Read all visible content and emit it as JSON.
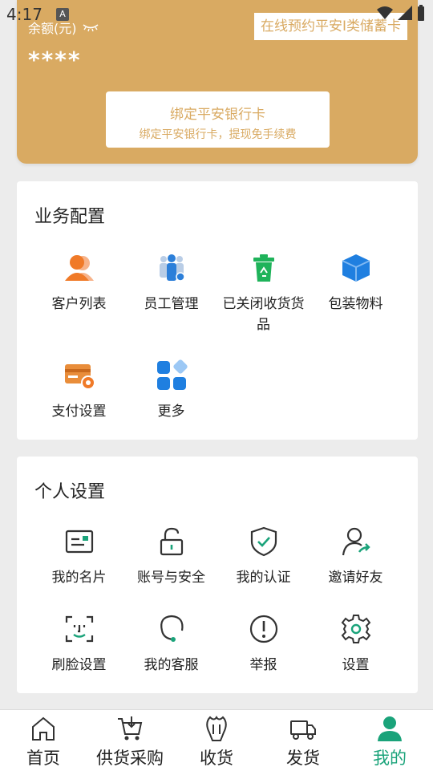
{
  "status_bar": {
    "time": "4:17",
    "notif_glyph": "A"
  },
  "balance": {
    "label": "余额(元)",
    "value": "****",
    "reserve_link": "在线预约平安I类储蓄卡",
    "bind_title": "绑定平安银行卡",
    "bind_subtitle": "绑定平安银行卡，提现免手续费"
  },
  "business": {
    "title": "业务配置",
    "items": [
      {
        "label": "客户列表",
        "icon": "customer-list-icon"
      },
      {
        "label": "员工管理",
        "icon": "staff-icon"
      },
      {
        "label": "已关闭收货货品",
        "icon": "recycle-bin-icon"
      },
      {
        "label": "包装物料",
        "icon": "package-icon"
      },
      {
        "label": "支付设置",
        "icon": "payment-card-icon"
      },
      {
        "label": "更多",
        "icon": "more-grid-icon"
      }
    ]
  },
  "personal": {
    "title": "个人设置",
    "items": [
      {
        "label": "我的名片",
        "icon": "id-card-icon"
      },
      {
        "label": "账号与安全",
        "icon": "lock-icon"
      },
      {
        "label": "我的认证",
        "icon": "shield-check-icon"
      },
      {
        "label": "邀请好友",
        "icon": "invite-user-icon"
      },
      {
        "label": "刷脸设置",
        "icon": "face-scan-icon"
      },
      {
        "label": "我的客服",
        "icon": "headset-icon"
      },
      {
        "label": "举报",
        "icon": "alert-icon"
      },
      {
        "label": "设置",
        "icon": "settings-gear-icon"
      }
    ]
  },
  "nav": {
    "items": [
      {
        "label": "首页"
      },
      {
        "label": "供货采购"
      },
      {
        "label": "收货"
      },
      {
        "label": "发货"
      },
      {
        "label": "我的"
      }
    ]
  },
  "colors": {
    "accent": "#1aa37a",
    "gold": "#d9aa62",
    "orange": "#f07a28",
    "blue": "#1f7fe0"
  }
}
